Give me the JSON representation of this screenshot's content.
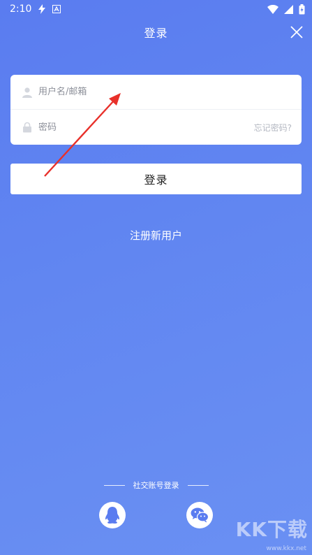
{
  "status_bar": {
    "time": "2:10"
  },
  "header": {
    "title": "登录"
  },
  "form": {
    "username_placeholder": "用户名/邮箱",
    "password_placeholder": "密码",
    "forgot_label": "忘记密码?"
  },
  "login_button": "登录",
  "register_label": "注册新用户",
  "social": {
    "title": "社交账号登录",
    "options": [
      "qq-icon",
      "wechat-icon"
    ]
  },
  "watermark": {
    "main": "KK下载",
    "sub": "www.kkx.net"
  },
  "colors": {
    "background": "#6186f1",
    "card": "#ffffff",
    "annotation_arrow": "#e8302a"
  }
}
